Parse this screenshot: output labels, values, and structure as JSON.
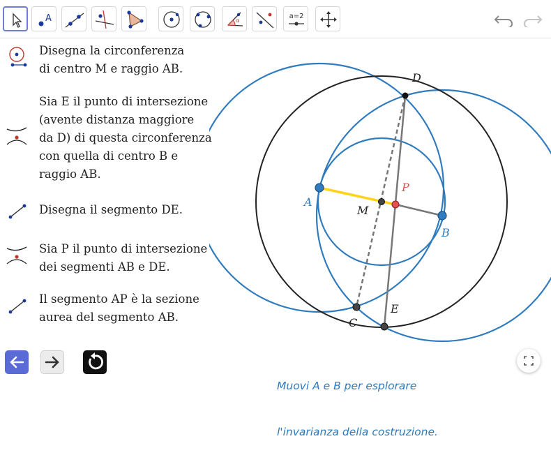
{
  "toolbar": {
    "tools": [
      {
        "name": "move-tool",
        "label": ""
      },
      {
        "name": "point-tool",
        "label": "A"
      },
      {
        "name": "line-tool",
        "label": ""
      },
      {
        "name": "perpendicular-tool",
        "label": ""
      },
      {
        "name": "polygon-tool",
        "label": ""
      },
      {
        "name": "circle-center-point-tool",
        "label": ""
      },
      {
        "name": "circle-three-points-tool",
        "label": ""
      },
      {
        "name": "angle-tool",
        "label": ""
      },
      {
        "name": "reflect-tool",
        "label": ""
      },
      {
        "name": "slider-tool",
        "label": "a=2"
      },
      {
        "name": "move-view-tool",
        "label": ""
      }
    ],
    "undo_icon": "undo-icon",
    "redo_icon": "redo-icon"
  },
  "steps": [
    {
      "icon": "circle-icon",
      "lines": [
        "Disegna la circonferenza",
        "di centro M e raggio AB."
      ]
    },
    {
      "icon": "intersect-icon",
      "lines": [
        "Sia E il punto di intersezione",
        "(avente distanza maggiore",
        "da D) di questa circonferenza",
        "con quella di centro B e",
        "raggio AB."
      ]
    },
    {
      "icon": "segment-icon",
      "lines": [
        "Disegna il segmento DE."
      ]
    },
    {
      "icon": "intersect-icon",
      "lines": [
        "Sia P il punto di intersezione",
        "dei segmenti AB e DE."
      ]
    },
    {
      "icon": "segment-icon",
      "lines": [
        "Il segmento AP è la sezione",
        "aurea del segmento AB."
      ]
    }
  ],
  "points": {
    "A": "A",
    "B": "B",
    "M": "M",
    "P": "P",
    "D": "D",
    "C": "C",
    "E": "E"
  },
  "colors": {
    "blue": "#2f7bbd",
    "yellow": "#ffd21a",
    "red": "#e05252",
    "black": "#222222",
    "gray": "#777777",
    "nav_blue": "#5b6bd6"
  },
  "caption": [
    "Muovi A e B per esplorare",
    "l'invarianza della costruzione."
  ],
  "nav": {
    "back_icon": "arrow-left-icon",
    "forward_icon": "arrow-right-icon",
    "reset_icon": "reset-icon",
    "fullscreen_icon": "fullscreen-icon"
  }
}
